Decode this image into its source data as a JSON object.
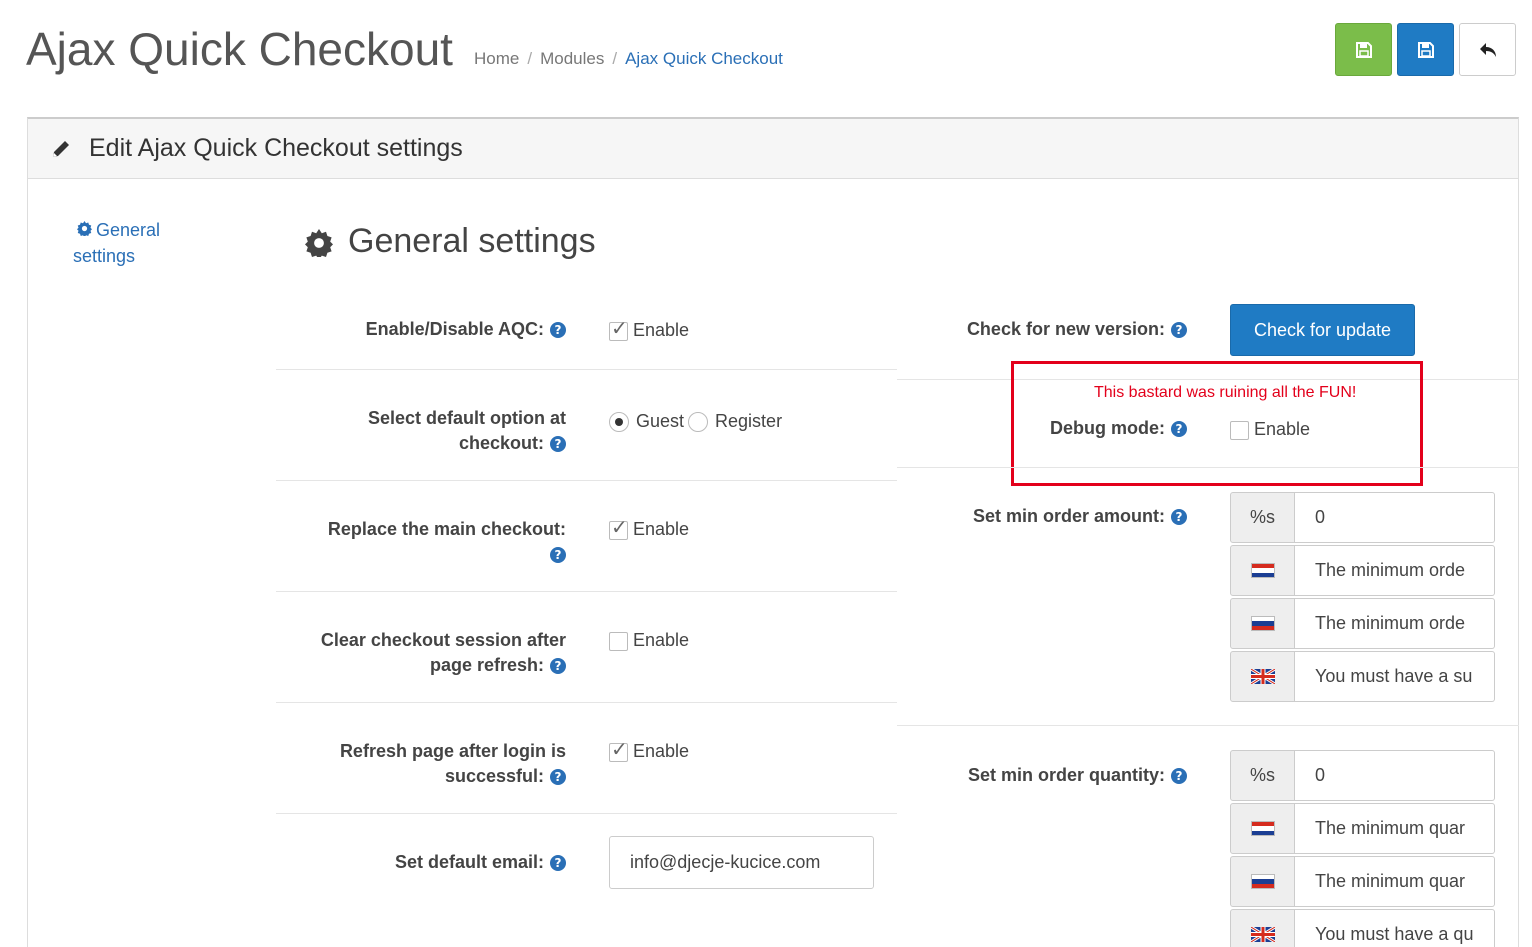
{
  "header": {
    "title": "Ajax Quick Checkout",
    "breadcrumb": [
      "Home",
      "Modules",
      "Ajax Quick Checkout"
    ],
    "buttons": {
      "save_stay": "save-icon",
      "save": "save-icon",
      "back": "undo-icon"
    }
  },
  "panel": {
    "title": "Edit Ajax Quick Checkout settings",
    "sidebar": {
      "item": "General settings"
    },
    "section_title": "General settings"
  },
  "left": {
    "enable_aqc": {
      "label": "Enable/Disable AQC:",
      "option": "Enable",
      "checked": true
    },
    "default_option": {
      "label_line1": "Select default option at",
      "label_line2": "checkout:",
      "options": [
        "Guest",
        "Register"
      ],
      "selected": "Guest"
    },
    "replace_checkout": {
      "label": "Replace the main checkout:",
      "option": "Enable",
      "checked": true
    },
    "clear_session": {
      "label_line1": "Clear checkout session after",
      "label_line2": "page refresh:",
      "option": "Enable",
      "checked": false
    },
    "refresh_page": {
      "label_line1": "Refresh page after login is",
      "label_line2": "successful:",
      "option": "Enable",
      "checked": true
    },
    "default_email": {
      "label": "Set default email:",
      "value": "info@djecje-kucice.com"
    }
  },
  "right": {
    "new_version": {
      "label": "Check for new version:",
      "button": "Check for update"
    },
    "annotation": "This bastard was ruining all the FUN!",
    "debug_mode": {
      "label": "Debug mode:",
      "option": "Enable",
      "checked": false
    },
    "min_amount": {
      "label": "Set min order amount:",
      "addon": "%s",
      "value": "0",
      "translations": [
        "The minimum orde",
        "The minimum orde",
        "You must have a su"
      ]
    },
    "min_quantity": {
      "label": "Set min order quantity:",
      "addon": "%s",
      "value": "0",
      "translations": [
        "The minimum quar",
        "The minimum quar",
        "You must have a qu"
      ]
    }
  },
  "colors": {
    "primary": "#1f7bc4",
    "success": "#7bbd4a",
    "annotation_red": "#e3001b",
    "link": "#2a6fb6"
  },
  "help_glyph": "?"
}
